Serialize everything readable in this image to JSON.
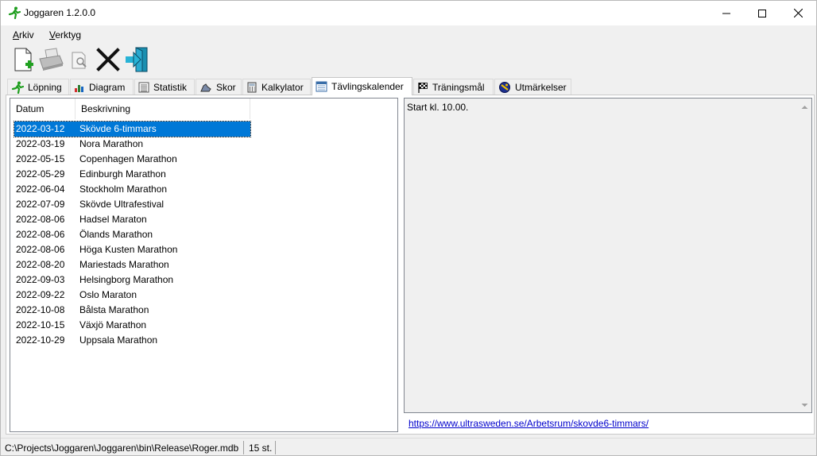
{
  "window": {
    "title": "Joggaren 1.2.0.0"
  },
  "menu": {
    "arkiv": {
      "accel": "A",
      "rest": "rkiv"
    },
    "verktyg": {
      "accel": "V",
      "rest": "erktyg"
    }
  },
  "toolbar": {
    "icons": [
      "new-document-icon",
      "print-icon",
      "print-preview-icon",
      "delete-icon",
      "exit-icon"
    ]
  },
  "tabs": [
    {
      "label": "Löpning",
      "icon": "runner-icon"
    },
    {
      "label": "Diagram",
      "icon": "bar-chart-icon"
    },
    {
      "label": "Statistik",
      "icon": "sheet-icon"
    },
    {
      "label": "Skor",
      "icon": "shoe-icon"
    },
    {
      "label": "Kalkylator",
      "icon": "calculator-icon"
    },
    {
      "label": "Tävlingskalender",
      "icon": "calendar-icon",
      "active": true
    },
    {
      "label": "Träningsmål",
      "icon": "checkered-flag-icon"
    },
    {
      "label": "Utmärkelser",
      "icon": "medal-icon"
    }
  ],
  "list": {
    "columns": [
      "Datum",
      "Beskrivning"
    ],
    "rows": [
      {
        "date": "2022-03-12",
        "desc": "Skövde 6-timmars"
      },
      {
        "date": "2022-03-19",
        "desc": "Nora Marathon"
      },
      {
        "date": "2022-05-15",
        "desc": "Copenhagen Marathon"
      },
      {
        "date": "2022-05-29",
        "desc": "Edinburgh Marathon"
      },
      {
        "date": "2022-06-04",
        "desc": "Stockholm Marathon"
      },
      {
        "date": "2022-07-09",
        "desc": "Skövde Ultrafestival"
      },
      {
        "date": "2022-08-06",
        "desc": "Hadsel Maraton"
      },
      {
        "date": "2022-08-06",
        "desc": "Ölands Marathon"
      },
      {
        "date": "2022-08-06",
        "desc": "Höga Kusten Marathon"
      },
      {
        "date": "2022-08-20",
        "desc": "Mariestads Marathon"
      },
      {
        "date": "2022-09-03",
        "desc": "Helsingborg Marathon"
      },
      {
        "date": "2022-09-22",
        "desc": "Oslo Maraton"
      },
      {
        "date": "2022-10-08",
        "desc": "Bålsta Marathon"
      },
      {
        "date": "2022-10-15",
        "desc": "Växjö Marathon"
      },
      {
        "date": "2022-10-29",
        "desc": "Uppsala Marathon"
      }
    ],
    "selected_index": 0
  },
  "detail": {
    "text": "Start kl. 10.00.",
    "link": "https://www.ultrasweden.se/Arbetsrum/skovde6-timmars/"
  },
  "status": {
    "path": "C:\\Projects\\Joggaren\\Joggaren\\bin\\Release\\Roger.mdb",
    "count": "15 st."
  },
  "colors": {
    "selection": "#0078d7",
    "link": "#0000cc"
  }
}
